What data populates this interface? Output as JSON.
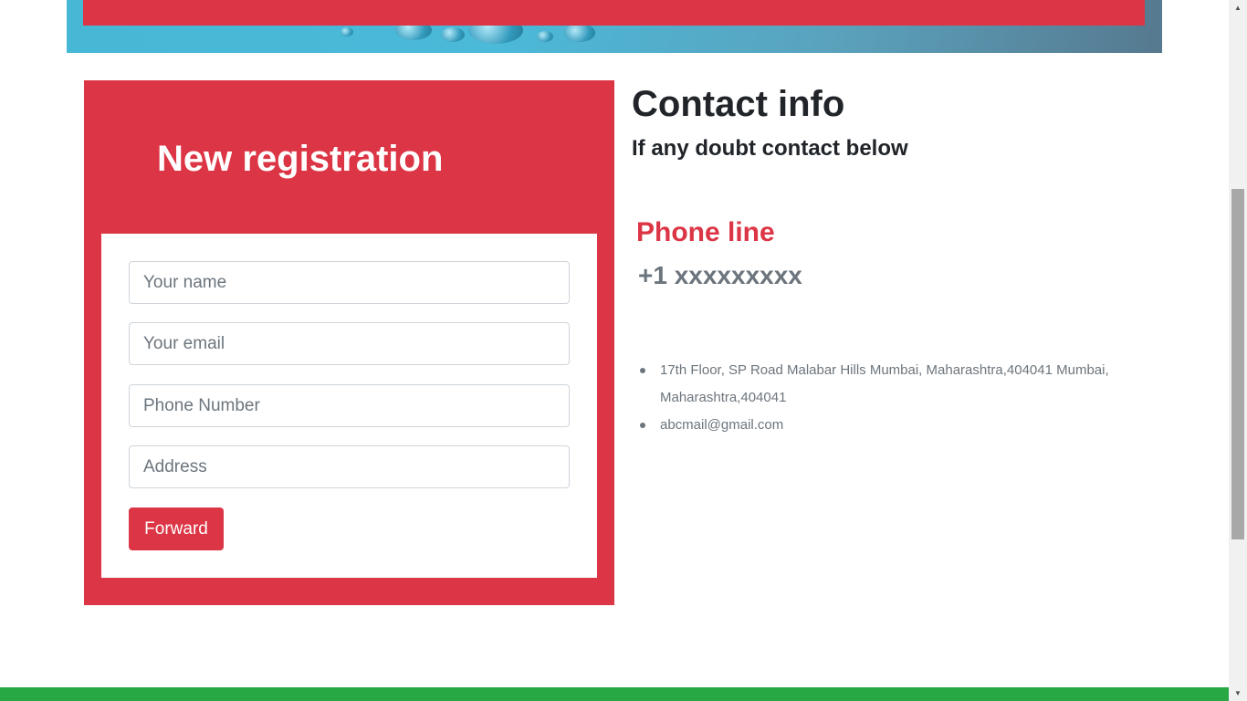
{
  "registration": {
    "title": "New registration",
    "name_placeholder": "Your name",
    "email_placeholder": "Your email",
    "phone_placeholder": "Phone Number",
    "address_placeholder": "Address",
    "submit_label": "Forward"
  },
  "contact": {
    "title": "Contact info",
    "subtitle": "If any doubt contact below",
    "phone_label": "Phone line",
    "phone_number": "+1 xxxxxxxxx",
    "address": "17th Floor, SP Road Malabar Hills Mumbai, Maharashtra,404041 Mumbai, Maharashtra,404041",
    "email": "abcmail@gmail.com"
  },
  "colors": {
    "accent": "#dc3545",
    "footer": "#28a745",
    "text_dark": "#212529",
    "text_muted": "#6c757d"
  },
  "icons": {
    "scroll_up": "triangle-up-icon",
    "scroll_down": "triangle-down-icon"
  }
}
